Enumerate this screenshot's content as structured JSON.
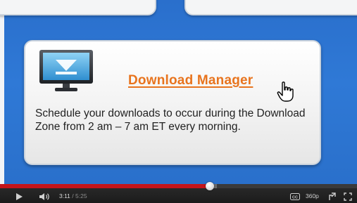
{
  "video": {
    "card": {
      "link_text": "Download Manager",
      "description": "Schedule your downloads to occur during the Download Zone from 2 am – 7 am ET every morning.",
      "link_color": "#e8741e"
    },
    "background_color": "#2f79d6"
  },
  "player": {
    "current_time": "3:11",
    "separator": " / ",
    "duration": "5:25",
    "progress_fraction": 0.588,
    "buffered_fraction": 0.02,
    "quality_label": "360p",
    "icons": {
      "play": "play-icon",
      "volume": "volume-icon",
      "cc": "closed-captions-icon",
      "popout": "popout-icon",
      "fullscreen": "fullscreen-icon"
    },
    "progress_color": "#c4151b"
  }
}
